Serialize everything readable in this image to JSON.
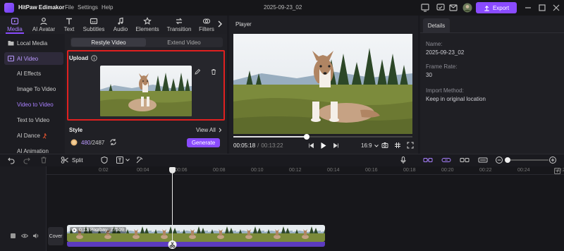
{
  "app": {
    "name": "HitPaw Edimakor",
    "menu": [
      "File",
      "Settings",
      "Help"
    ],
    "project_title": "2025-09-23_02",
    "export_label": "Export"
  },
  "tabs": [
    {
      "label": "Media",
      "icon": "media-icon",
      "active": true
    },
    {
      "label": "AI Avatar",
      "icon": "avatar-icon"
    },
    {
      "label": "Text",
      "icon": "text-icon"
    },
    {
      "label": "Subtitles",
      "icon": "subtitles-icon"
    },
    {
      "label": "Audio",
      "icon": "music-icon"
    },
    {
      "label": "Elements",
      "icon": "elements-icon"
    },
    {
      "label": "Transition",
      "icon": "transition-icon"
    },
    {
      "label": "Filters",
      "icon": "filters-icon"
    }
  ],
  "sidebar": {
    "local_media": "Local Media",
    "ai_video": "AI Video",
    "items": [
      "AI Effects",
      "Image To Video",
      "Video to Video",
      "Text to Video",
      "AI Dance",
      "AI Animation"
    ],
    "active_item": "Video to Video"
  },
  "panel": {
    "subtabs": [
      "Restyle Video",
      "Extend Video"
    ],
    "upload_label": "Upload",
    "style_label": "Style",
    "view_all": "View All",
    "credits_used": "480",
    "credits_total": "/2487",
    "generate_label": "Generate"
  },
  "player": {
    "title": "Player",
    "current_time": "00:05:18",
    "separator": "/",
    "total_time": "00:13:22",
    "aspect": "16:9",
    "progress": 0.41
  },
  "details": {
    "tab": "Details",
    "name_label": "Name:",
    "name_value": "2025-09-23_02",
    "frame_rate_label": "Frame Rate:",
    "frame_rate_value": "30",
    "import_label": "Import Method:",
    "import_value": "Keep in original location"
  },
  "timeline": {
    "split_label": "Split",
    "ticks": [
      "0:02",
      "00:04",
      "00:06",
      "00:08",
      "00:10",
      "00:12",
      "00:14",
      "00:16",
      "00:18",
      "00:20",
      "00:22",
      "00:24",
      "00:26"
    ],
    "cover_label": "Cover",
    "clip_label": "0:13 Pixabay_77509"
  }
}
